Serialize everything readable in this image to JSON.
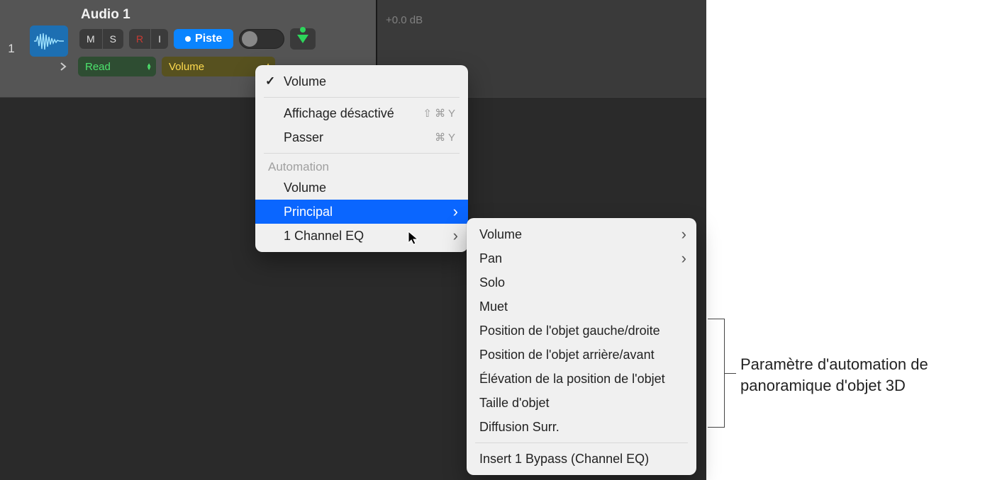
{
  "track": {
    "number": "1",
    "name": "Audio 1",
    "buttons": {
      "m": "M",
      "s": "S",
      "r": "R",
      "i": "I"
    },
    "mode_button": "Piste",
    "automation_mode": "Read",
    "automation_param": "Volume",
    "db_label": "+0.0 dB"
  },
  "menu1": {
    "volume": "Volume",
    "display_off": "Affichage désactivé",
    "display_off_sc": "⇧ ⌘ Y",
    "passer": "Passer",
    "passer_sc": "⌘ Y",
    "header": "Automation",
    "auto_volume": "Volume",
    "principal": "Principal",
    "ch_eq": "1 Channel EQ"
  },
  "menu2": {
    "volume": "Volume",
    "pan": "Pan",
    "solo": "Solo",
    "muet": "Muet",
    "pos_lr": "Position de l'objet gauche/droite",
    "pos_fb": "Position de l'objet arrière/avant",
    "elev": "Élévation de la position de l'objet",
    "size": "Taille d'objet",
    "diff": "Diffusion Surr.",
    "insert": "Insert 1 Bypass (Channel EQ)"
  },
  "callout": {
    "line1": "Paramètre d'automation de",
    "line2": "panoramique d'objet 3D"
  }
}
